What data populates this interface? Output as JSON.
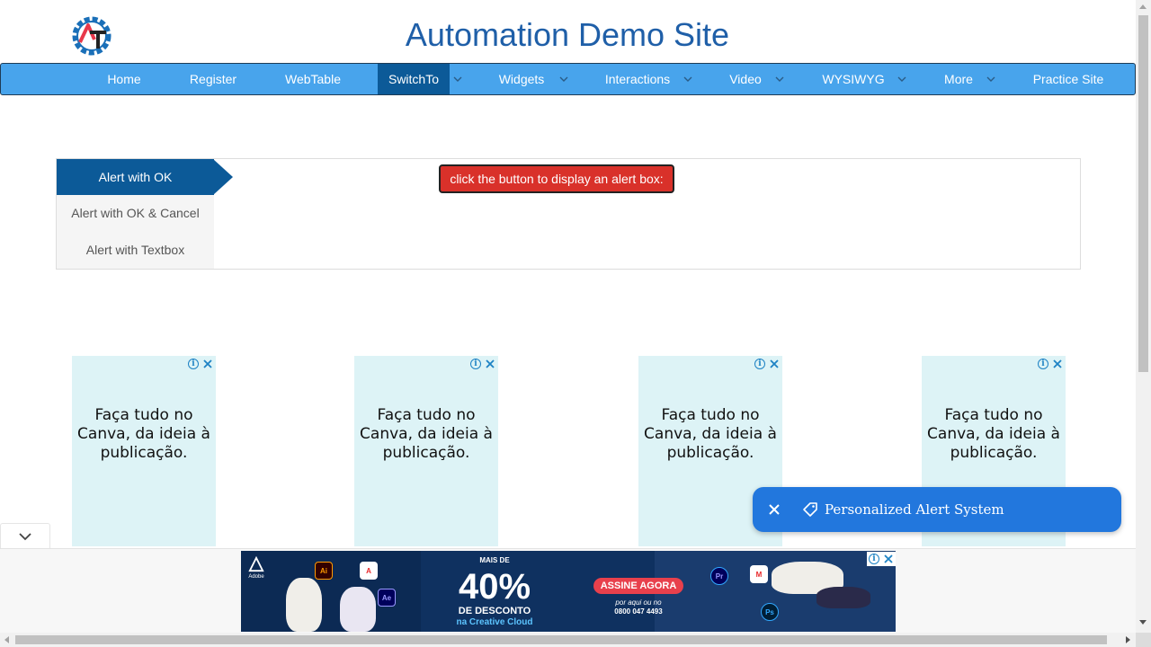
{
  "site": {
    "title": "Automation Demo Site"
  },
  "nav": {
    "items": [
      {
        "label": "Home"
      },
      {
        "label": "Register"
      },
      {
        "label": "WebTable"
      },
      {
        "label": "SwitchTo",
        "active": true
      },
      {
        "label": "Widgets"
      },
      {
        "label": "Interactions"
      },
      {
        "label": "Video"
      },
      {
        "label": "WYSIWYG"
      },
      {
        "label": "More"
      },
      {
        "label": "Practice Site"
      }
    ]
  },
  "alerts": {
    "tabs": [
      {
        "label": "Alert with OK",
        "active": true
      },
      {
        "label": "Alert with OK & Cancel"
      },
      {
        "label": "Alert with Textbox"
      }
    ],
    "button_label": "click the button to display an alert box:"
  },
  "ads": {
    "cards": [
      {
        "text": "Faça tudo no Canva, da ideia à publicação."
      },
      {
        "text": "Faça tudo no Canva, da ideia à publicação."
      },
      {
        "text": "Faça tudo no Canva, da ideia à publicação."
      },
      {
        "text": "Faça tudo no Canva, da ideia à publicação."
      }
    ],
    "banner": {
      "brand": "Adobe",
      "mais_de": "MAIS DE",
      "percent": "40%",
      "desconto": "DE DESCONTO",
      "creative_cloud": "na Creative Cloud",
      "cta": "ASSINE AGORA",
      "phone_line1": "por aqui ou no",
      "phone_line2": "0800 047 4493"
    }
  },
  "toast": {
    "text": "Personalized Alert System"
  },
  "colors": {
    "nav_bg": "#48a4ec",
    "nav_active": "#0c5a98",
    "alert_button": "#d9312a",
    "toast_bg": "#2277dd",
    "title": "#1f5fa8"
  }
}
